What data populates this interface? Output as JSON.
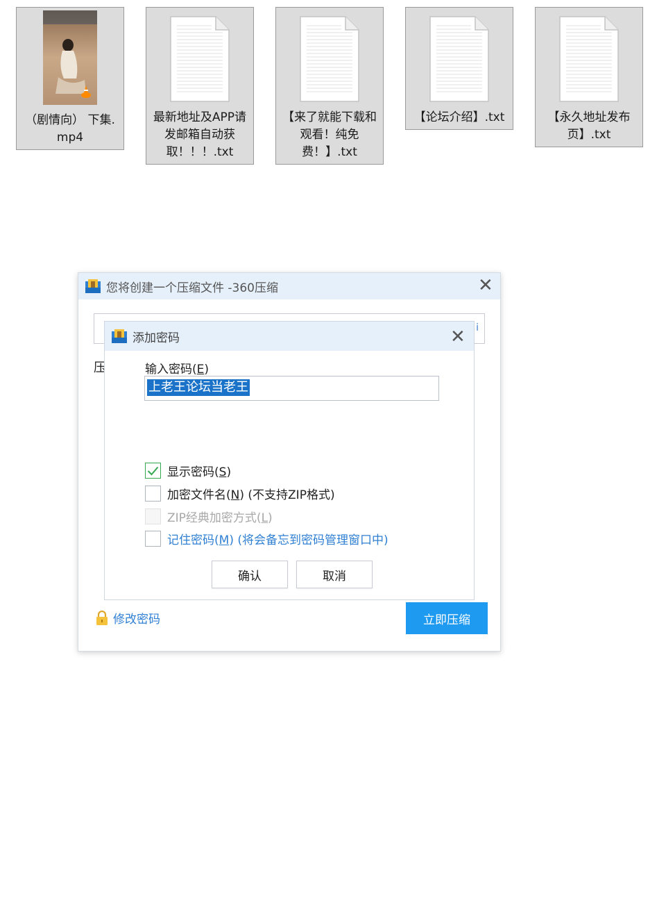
{
  "files": [
    {
      "name": "（剧情向） 下集.mp4",
      "type": "video"
    },
    {
      "name": "最新地址及APP请发邮箱自动获取！！！.txt",
      "type": "text"
    },
    {
      "name": "【来了就能下载和观看！纯免费！】.txt",
      "type": "text"
    },
    {
      "name": "【论坛介绍】.txt",
      "type": "text"
    },
    {
      "name": "【永久地址发布页】.txt",
      "type": "text"
    }
  ],
  "outer_dialog": {
    "title": "您将创建一个压缩文件 -360压缩",
    "field_tail": "i",
    "label_fragment": "压",
    "modify_password_link": "修改密码",
    "compress_now_button": "立即压缩",
    "app_icon": "archive-icon",
    "lock_icon": "lock-icon"
  },
  "inner_dialog": {
    "title": "添加密码",
    "password_label": "输入密码",
    "password_label_key": "E",
    "password_value": "上老王论坛当老王",
    "options": [
      {
        "label": "显示密码",
        "key": "S",
        "suffix": "",
        "checked": true,
        "disabled": false,
        "link": false
      },
      {
        "label": "加密文件名",
        "key": "N",
        "suffix": " (不支持ZIP格式)",
        "checked": false,
        "disabled": false,
        "link": false
      },
      {
        "label": "ZIP经典加密方式",
        "key": "L",
        "suffix": "",
        "checked": false,
        "disabled": true,
        "link": false
      },
      {
        "label": "记住密码",
        "key": "M",
        "suffix": " (将会备忘到密码管理窗口中)",
        "checked": false,
        "disabled": false,
        "link": true
      }
    ],
    "confirm_button": "确认",
    "cancel_button": "取消"
  },
  "colors": {
    "titlebar": "#e6f0fb",
    "accent": "#1e9af0",
    "link": "#2f7fd3",
    "selection": "#1a73c9",
    "check_green": "#35a852"
  }
}
